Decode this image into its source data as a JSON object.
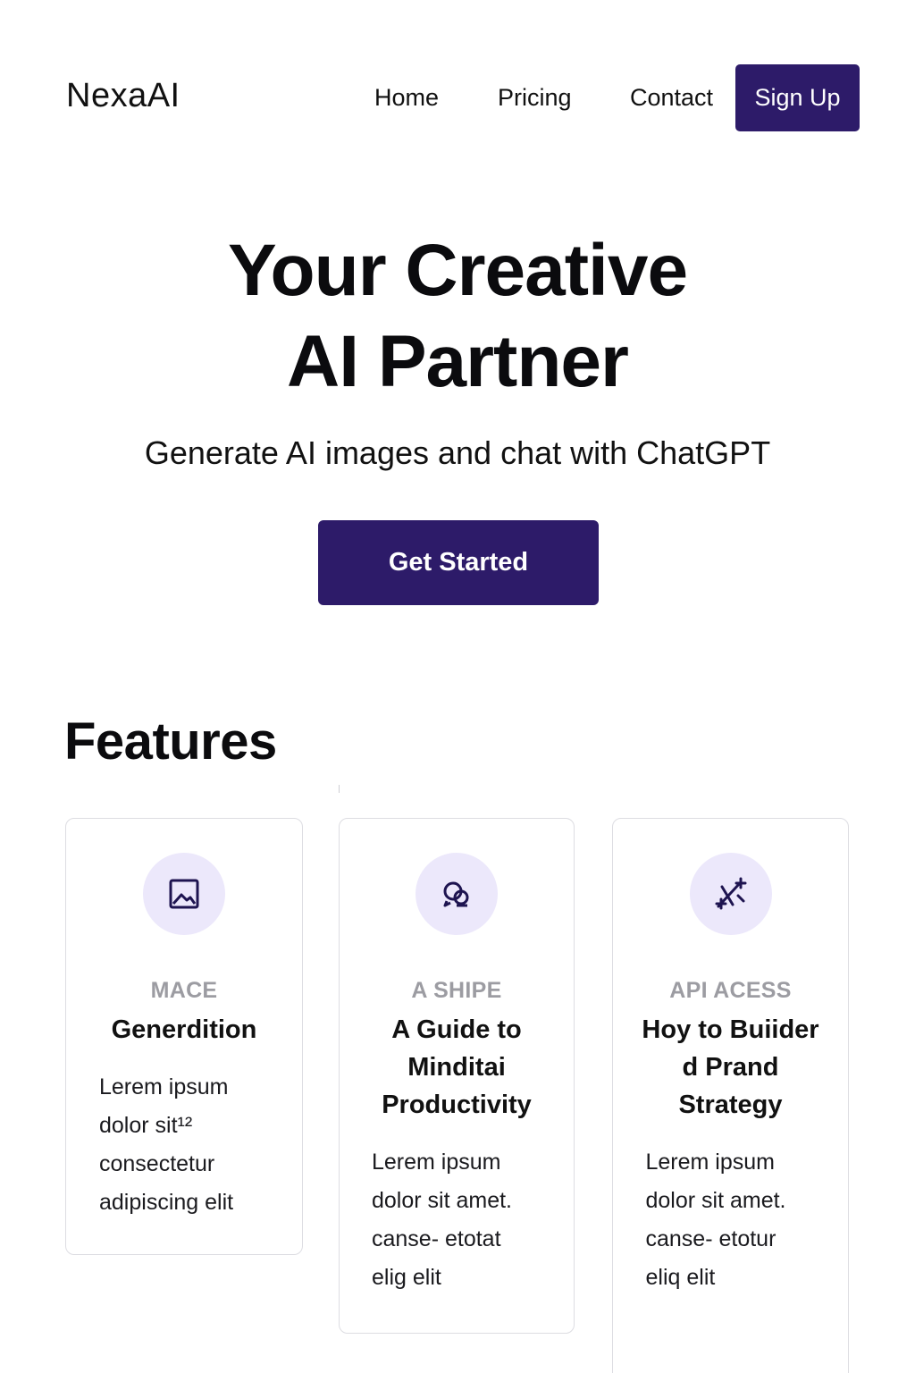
{
  "header": {
    "logo": "NexaAI",
    "nav": {
      "home": "Home",
      "pricing": "Pricing",
      "contact": "Contact"
    },
    "signup_label": "Sign Up"
  },
  "hero": {
    "title_line1": "Your Creative",
    "title_line2": "AI Partner",
    "subtitle": "Generate AI images and chat with ChatGPT",
    "cta_label": "Get Started"
  },
  "features": {
    "title": "Features",
    "cards": [
      {
        "icon": "image-icon",
        "tag": "MACE",
        "title": "Generdition",
        "text": "Lerem ipsum dolor sit¹² consectetur adipiscing elit"
      },
      {
        "icon": "chat-icon",
        "tag": "A SHIPE",
        "title": "A Guide to Minditai Productivity",
        "text": "Lerem ipsum dolor sit amet. canse- etotat elig elit"
      },
      {
        "icon": "sparkle-icon",
        "tag": "API ACESS",
        "title": "Hoy to Buiider d Prand Strategy",
        "text": "Lerem ipsum dolor sit amet. canse- etotur eliq elit"
      }
    ]
  },
  "colors": {
    "primary": "#2d1b69",
    "icon_bg": "#ece8fb",
    "tag": "#9c9ca2",
    "card_border": "#dddde2"
  }
}
